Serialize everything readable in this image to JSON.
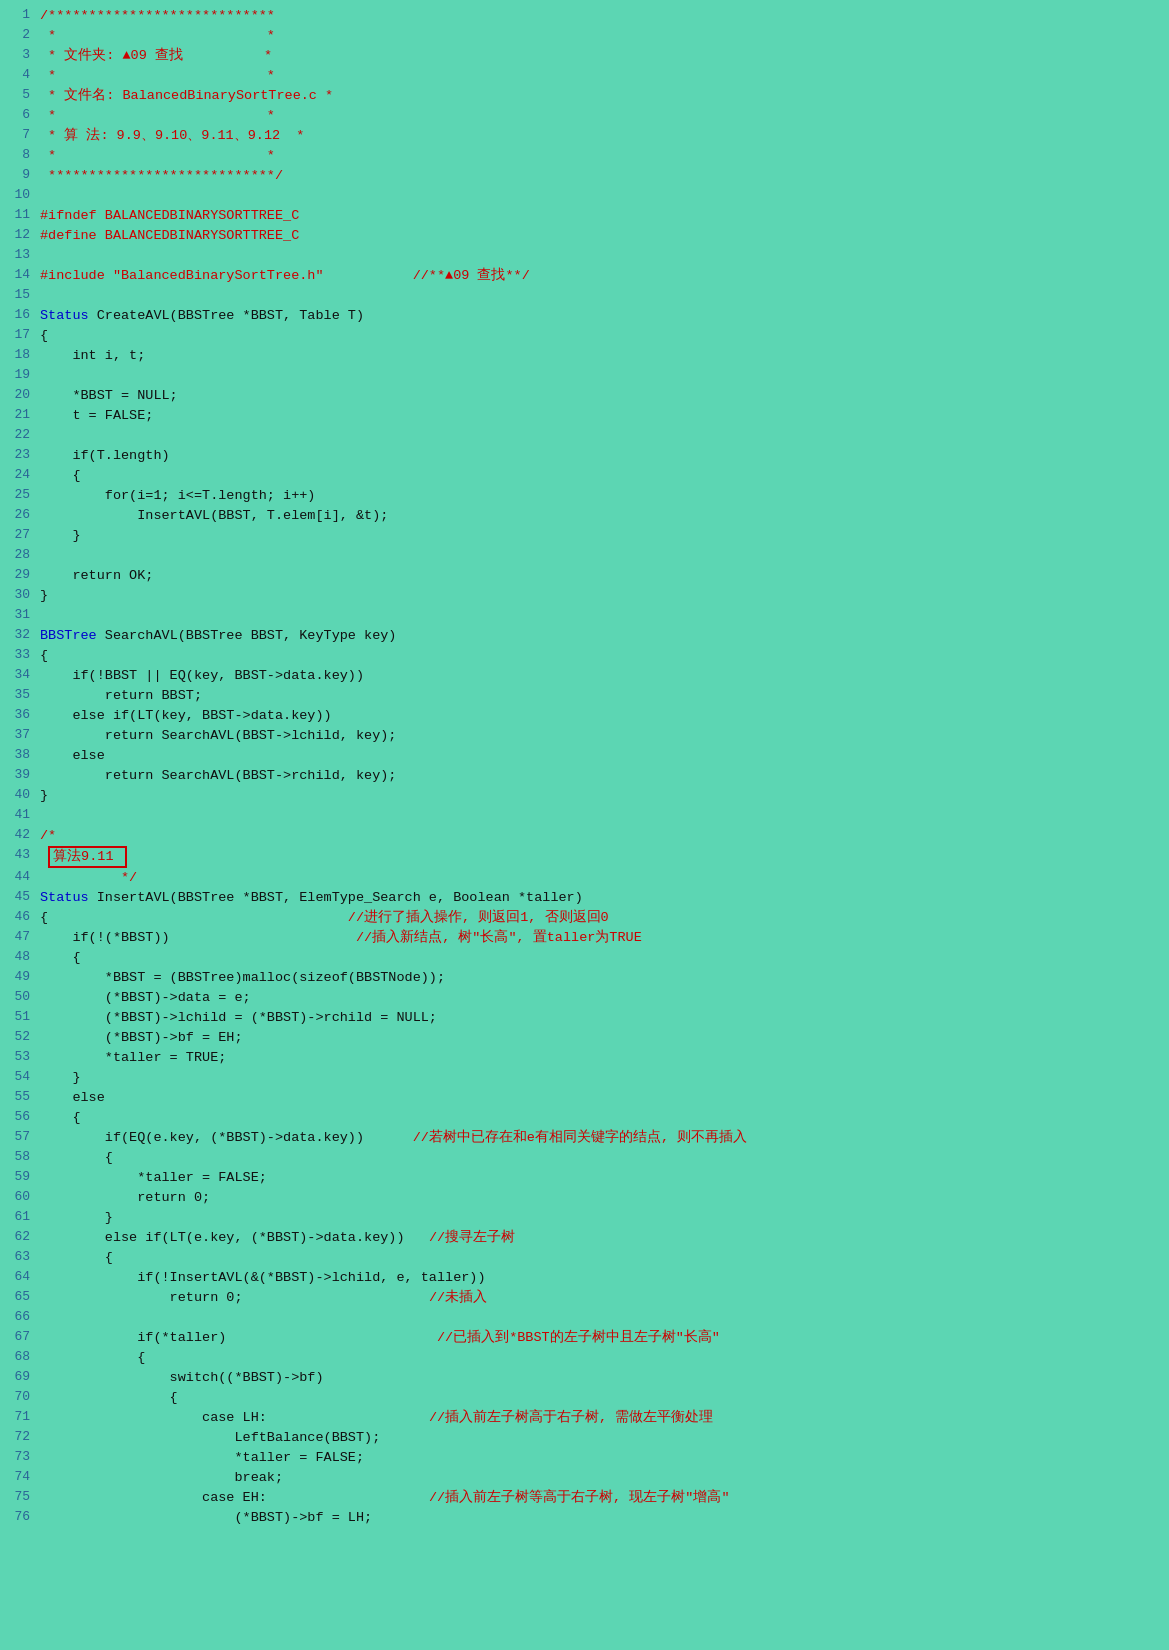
{
  "lines": [
    {
      "num": 1,
      "content": [
        {
          "text": "/****************************",
          "cls": "comment"
        }
      ]
    },
    {
      "num": 2,
      "content": [
        {
          "text": " *                          *",
          "cls": "comment"
        }
      ]
    },
    {
      "num": 3,
      "content": [
        {
          "text": " * 文件夹: ▲09 查找          *",
          "cls": "comment"
        }
      ]
    },
    {
      "num": 4,
      "content": [
        {
          "text": " *                          *",
          "cls": "comment"
        }
      ]
    },
    {
      "num": 5,
      "content": [
        {
          "text": " * 文件名: BalancedBinarySortTree.c *",
          "cls": "comment"
        }
      ]
    },
    {
      "num": 6,
      "content": [
        {
          "text": " *                          *",
          "cls": "comment"
        }
      ]
    },
    {
      "num": 7,
      "content": [
        {
          "text": " * 算 法: 9.9、9.10、9.11、9.12  *",
          "cls": "comment"
        }
      ]
    },
    {
      "num": 8,
      "content": [
        {
          "text": " *                          *",
          "cls": "comment"
        }
      ]
    },
    {
      "num": 9,
      "content": [
        {
          "text": " ****************************/",
          "cls": "comment"
        }
      ]
    },
    {
      "num": 10,
      "content": []
    },
    {
      "num": 11,
      "content": [
        {
          "text": "#ifndef BALANCEDBINARYSORTTREE_C",
          "cls": "red"
        }
      ]
    },
    {
      "num": 12,
      "content": [
        {
          "text": "#define BALANCEDBINARYSORTTREE_C",
          "cls": "red"
        }
      ]
    },
    {
      "num": 13,
      "content": []
    },
    {
      "num": 14,
      "content": [
        {
          "text": "#include \"BalancedBinarySortTree.h\"",
          "cls": "red"
        },
        {
          "text": "           //**▲09 查找**/",
          "cls": "comment"
        }
      ]
    },
    {
      "num": 15,
      "content": []
    },
    {
      "num": 16,
      "content": [
        {
          "text": "Status",
          "cls": "type-color"
        },
        {
          "text": " CreateAVL(",
          "cls": "func-color"
        },
        {
          "text": "BBSTree *BBST, Table T)",
          "cls": "black"
        }
      ]
    },
    {
      "num": 17,
      "content": [
        {
          "text": "{",
          "cls": "black"
        }
      ]
    },
    {
      "num": 18,
      "content": [
        {
          "text": "    int i, t;",
          "cls": "black"
        }
      ]
    },
    {
      "num": 19,
      "content": []
    },
    {
      "num": 20,
      "content": [
        {
          "text": "    *BBST = NULL;",
          "cls": "black"
        }
      ]
    },
    {
      "num": 21,
      "content": [
        {
          "text": "    t = FALSE;",
          "cls": "black"
        }
      ]
    },
    {
      "num": 22,
      "content": []
    },
    {
      "num": 23,
      "content": [
        {
          "text": "    if(T.length)",
          "cls": "black"
        }
      ]
    },
    {
      "num": 24,
      "content": [
        {
          "text": "    {",
          "cls": "black"
        }
      ]
    },
    {
      "num": 25,
      "content": [
        {
          "text": "        for(i=1; i<=T.length; i++)",
          "cls": "black"
        }
      ]
    },
    {
      "num": 26,
      "content": [
        {
          "text": "            InsertAVL(BBST, T.elem[i], &t);",
          "cls": "black"
        }
      ]
    },
    {
      "num": 27,
      "content": [
        {
          "text": "    }",
          "cls": "black"
        }
      ]
    },
    {
      "num": 28,
      "content": []
    },
    {
      "num": 29,
      "content": [
        {
          "text": "    return OK;",
          "cls": "black"
        }
      ]
    },
    {
      "num": 30,
      "content": [
        {
          "text": "}",
          "cls": "black"
        }
      ]
    },
    {
      "num": 31,
      "content": []
    },
    {
      "num": 32,
      "content": [
        {
          "text": "BBSTree",
          "cls": "type-color"
        },
        {
          "text": " SearchAVL(BBSTree BBST, KeyType key)",
          "cls": "black"
        }
      ]
    },
    {
      "num": 33,
      "content": [
        {
          "text": "{",
          "cls": "black"
        }
      ]
    },
    {
      "num": 34,
      "content": [
        {
          "text": "    if(!BBST || EQ(key, BBST->data.key))",
          "cls": "black"
        }
      ]
    },
    {
      "num": 35,
      "content": [
        {
          "text": "        return BBST;",
          "cls": "black"
        }
      ]
    },
    {
      "num": 36,
      "content": [
        {
          "text": "    else if(LT(key, BBST->data.key))",
          "cls": "black"
        }
      ]
    },
    {
      "num": 37,
      "content": [
        {
          "text": "        return SearchAVL(BBST->lchild, key);",
          "cls": "black"
        }
      ]
    },
    {
      "num": 38,
      "content": [
        {
          "text": "    else",
          "cls": "black"
        }
      ]
    },
    {
      "num": 39,
      "content": [
        {
          "text": "        return SearchAVL(BBST->rchild, key);",
          "cls": "black"
        }
      ]
    },
    {
      "num": 40,
      "content": [
        {
          "text": "}",
          "cls": "black"
        }
      ]
    },
    {
      "num": 41,
      "content": []
    },
    {
      "num": 42,
      "content": [
        {
          "text": "/*",
          "cls": "comment"
        }
      ]
    },
    {
      "num": 43,
      "content": [
        {
          "text": " 算法9.11 ",
          "cls": "comment",
          "boxed": true
        }
      ]
    },
    {
      "num": 44,
      "content": [
        {
          "text": "          */",
          "cls": "comment"
        }
      ]
    },
    {
      "num": 45,
      "content": [
        {
          "text": "Status",
          "cls": "type-color"
        },
        {
          "text": " InsertAVL(BBSTree *BBST, ElemType_Search e, Boolean *taller)",
          "cls": "black"
        }
      ]
    },
    {
      "num": 46,
      "content": [
        {
          "text": "{                                     //进行了插入操作, 则返回1, 否则返回0",
          "cls": "black",
          "comment_part": "//进行了插入操作, 则返回1, 否则返回0"
        }
      ]
    },
    {
      "num": 47,
      "content": [
        {
          "text": "    if(!(*BBST))                       //插入新结点, 树\"长高\", 置taller为TRUE",
          "cls": "black"
        }
      ]
    },
    {
      "num": 48,
      "content": [
        {
          "text": "    {",
          "cls": "black"
        }
      ]
    },
    {
      "num": 49,
      "content": [
        {
          "text": "        *BBST = (BBSTree)malloc(sizeof(BBSTNode));",
          "cls": "black"
        }
      ]
    },
    {
      "num": 50,
      "content": [
        {
          "text": "        (*BBST)->data = e;",
          "cls": "black"
        }
      ]
    },
    {
      "num": 51,
      "content": [
        {
          "text": "        (*BBST)->lchild = (*BBST)->rchild = NULL;",
          "cls": "black"
        }
      ]
    },
    {
      "num": 52,
      "content": [
        {
          "text": "        (*BBST)->bf = EH;",
          "cls": "black"
        }
      ]
    },
    {
      "num": 53,
      "content": [
        {
          "text": "        *taller = TRUE;",
          "cls": "black"
        }
      ]
    },
    {
      "num": 54,
      "content": [
        {
          "text": "    }",
          "cls": "black"
        }
      ]
    },
    {
      "num": 55,
      "content": [
        {
          "text": "    else",
          "cls": "black"
        }
      ]
    },
    {
      "num": 56,
      "content": [
        {
          "text": "    {",
          "cls": "black"
        }
      ]
    },
    {
      "num": 57,
      "content": [
        {
          "text": "        if(EQ(e.key, (*BBST)->data.key))      //若树中已存在和e有相同关键字的结点, 则不再插入",
          "cls": "black"
        }
      ]
    },
    {
      "num": 58,
      "content": [
        {
          "text": "        {",
          "cls": "black"
        }
      ]
    },
    {
      "num": 59,
      "content": [
        {
          "text": "            *taller = FALSE;",
          "cls": "black"
        }
      ]
    },
    {
      "num": 60,
      "content": [
        {
          "text": "            return 0;",
          "cls": "black"
        }
      ]
    },
    {
      "num": 61,
      "content": [
        {
          "text": "        }",
          "cls": "black"
        }
      ]
    },
    {
      "num": 62,
      "content": [
        {
          "text": "        else if(LT(e.key, (*BBST)->data.key))   //搜寻左子树",
          "cls": "black"
        }
      ]
    },
    {
      "num": 63,
      "content": [
        {
          "text": "        {",
          "cls": "black"
        }
      ]
    },
    {
      "num": 64,
      "content": [
        {
          "text": "            if(!InsertAVL(&(*BBST)->lchild, e, taller))",
          "cls": "black"
        }
      ]
    },
    {
      "num": 65,
      "content": [
        {
          "text": "                return 0;                       //未插入",
          "cls": "black"
        }
      ]
    },
    {
      "num": 66,
      "content": []
    },
    {
      "num": 67,
      "content": [
        {
          "text": "            if(*taller)                          //已插入到*BBST的左子树中且左子树\"长高\"",
          "cls": "black"
        }
      ]
    },
    {
      "num": 68,
      "content": [
        {
          "text": "            {",
          "cls": "black"
        }
      ]
    },
    {
      "num": 69,
      "content": [
        {
          "text": "                switch((*BBST)->bf)",
          "cls": "black"
        }
      ]
    },
    {
      "num": 70,
      "content": [
        {
          "text": "                {",
          "cls": "black"
        }
      ]
    },
    {
      "num": 71,
      "content": [
        {
          "text": "                    case LH:                    //插入前左子树高于右子树, 需做左平衡处理",
          "cls": "black"
        }
      ]
    },
    {
      "num": 72,
      "content": [
        {
          "text": "                        LeftBalance(BBST);",
          "cls": "black"
        }
      ]
    },
    {
      "num": 73,
      "content": [
        {
          "text": "                        *taller = FALSE;",
          "cls": "black"
        }
      ]
    },
    {
      "num": 74,
      "content": [
        {
          "text": "                        break;",
          "cls": "black"
        }
      ]
    },
    {
      "num": 75,
      "content": [
        {
          "text": "                    case EH:                    //插入前左子树等高于右子树, 现左子树\"增高\"",
          "cls": "black"
        }
      ]
    },
    {
      "num": 76,
      "content": [
        {
          "text": "                        (*BBST)->bf = LH;",
          "cls": "black"
        }
      ]
    }
  ]
}
